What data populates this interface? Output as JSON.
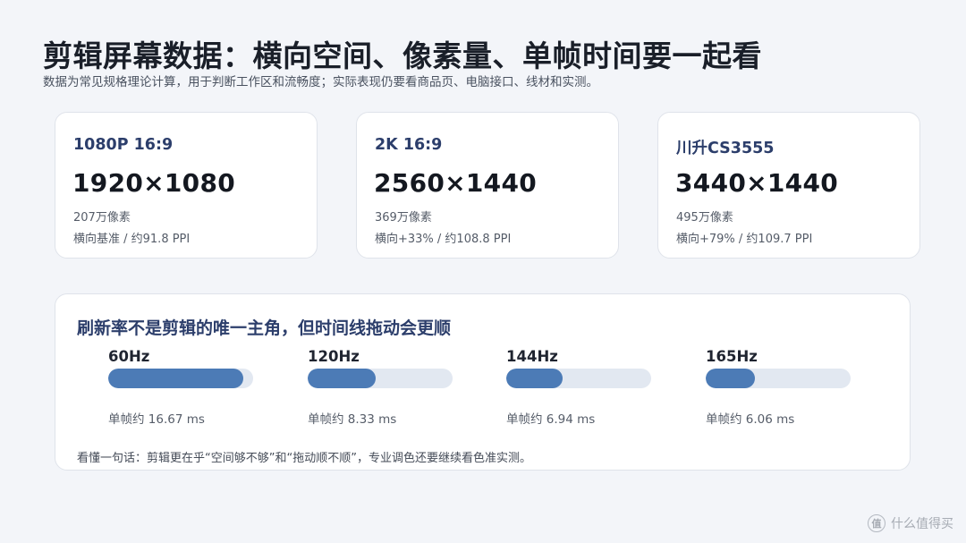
{
  "header": {
    "title": "剪辑屏幕数据：横向空间、像素量、单帧时间要一起看",
    "subtitle": "数据为常见规格理论计算，用于判断工作区和流畅度；实际表现仍要看商品页、电脑接口、线材和实测。"
  },
  "cards": [
    {
      "name": "1080P 16:9",
      "resolution": "1920×1080",
      "pixels": "207万像素",
      "detail": "横向基准 / 约91.8 PPI"
    },
    {
      "name": "2K 16:9",
      "resolution": "2560×1440",
      "pixels": "369万像素",
      "detail": "横向+33% / 约108.8 PPI"
    },
    {
      "name": "川升CS3555",
      "resolution": "3440×1440",
      "pixels": "495万像素",
      "detail": "横向+79% / 约109.7 PPI"
    }
  ],
  "refresh": {
    "title": "刷新率不是剪辑的唯一主角，但时间线拖动会更顺",
    "items": [
      {
        "label": "60Hz",
        "frame_time": "单帧约 16.67 ms",
        "fill_fraction": 0.93
      },
      {
        "label": "120Hz",
        "frame_time": "单帧约 8.33 ms",
        "fill_fraction": 0.47
      },
      {
        "label": "144Hz",
        "frame_time": "单帧约 6.94 ms",
        "fill_fraction": 0.39
      },
      {
        "label": "165Hz",
        "frame_time": "单帧约 6.06 ms",
        "fill_fraction": 0.34
      }
    ],
    "note": "看懂一句话：剪辑更在乎“空间够不够”和“拖动顺不顺”，专业调色还要继续看色准实测。"
  },
  "watermark": {
    "icon": "zhi-logo-icon",
    "icon_glyph": "值",
    "text": "什么值得买"
  },
  "colors": {
    "accent": "#4c7bb6",
    "track": "#e2e8f1",
    "heading": "#2c3e6b"
  }
}
